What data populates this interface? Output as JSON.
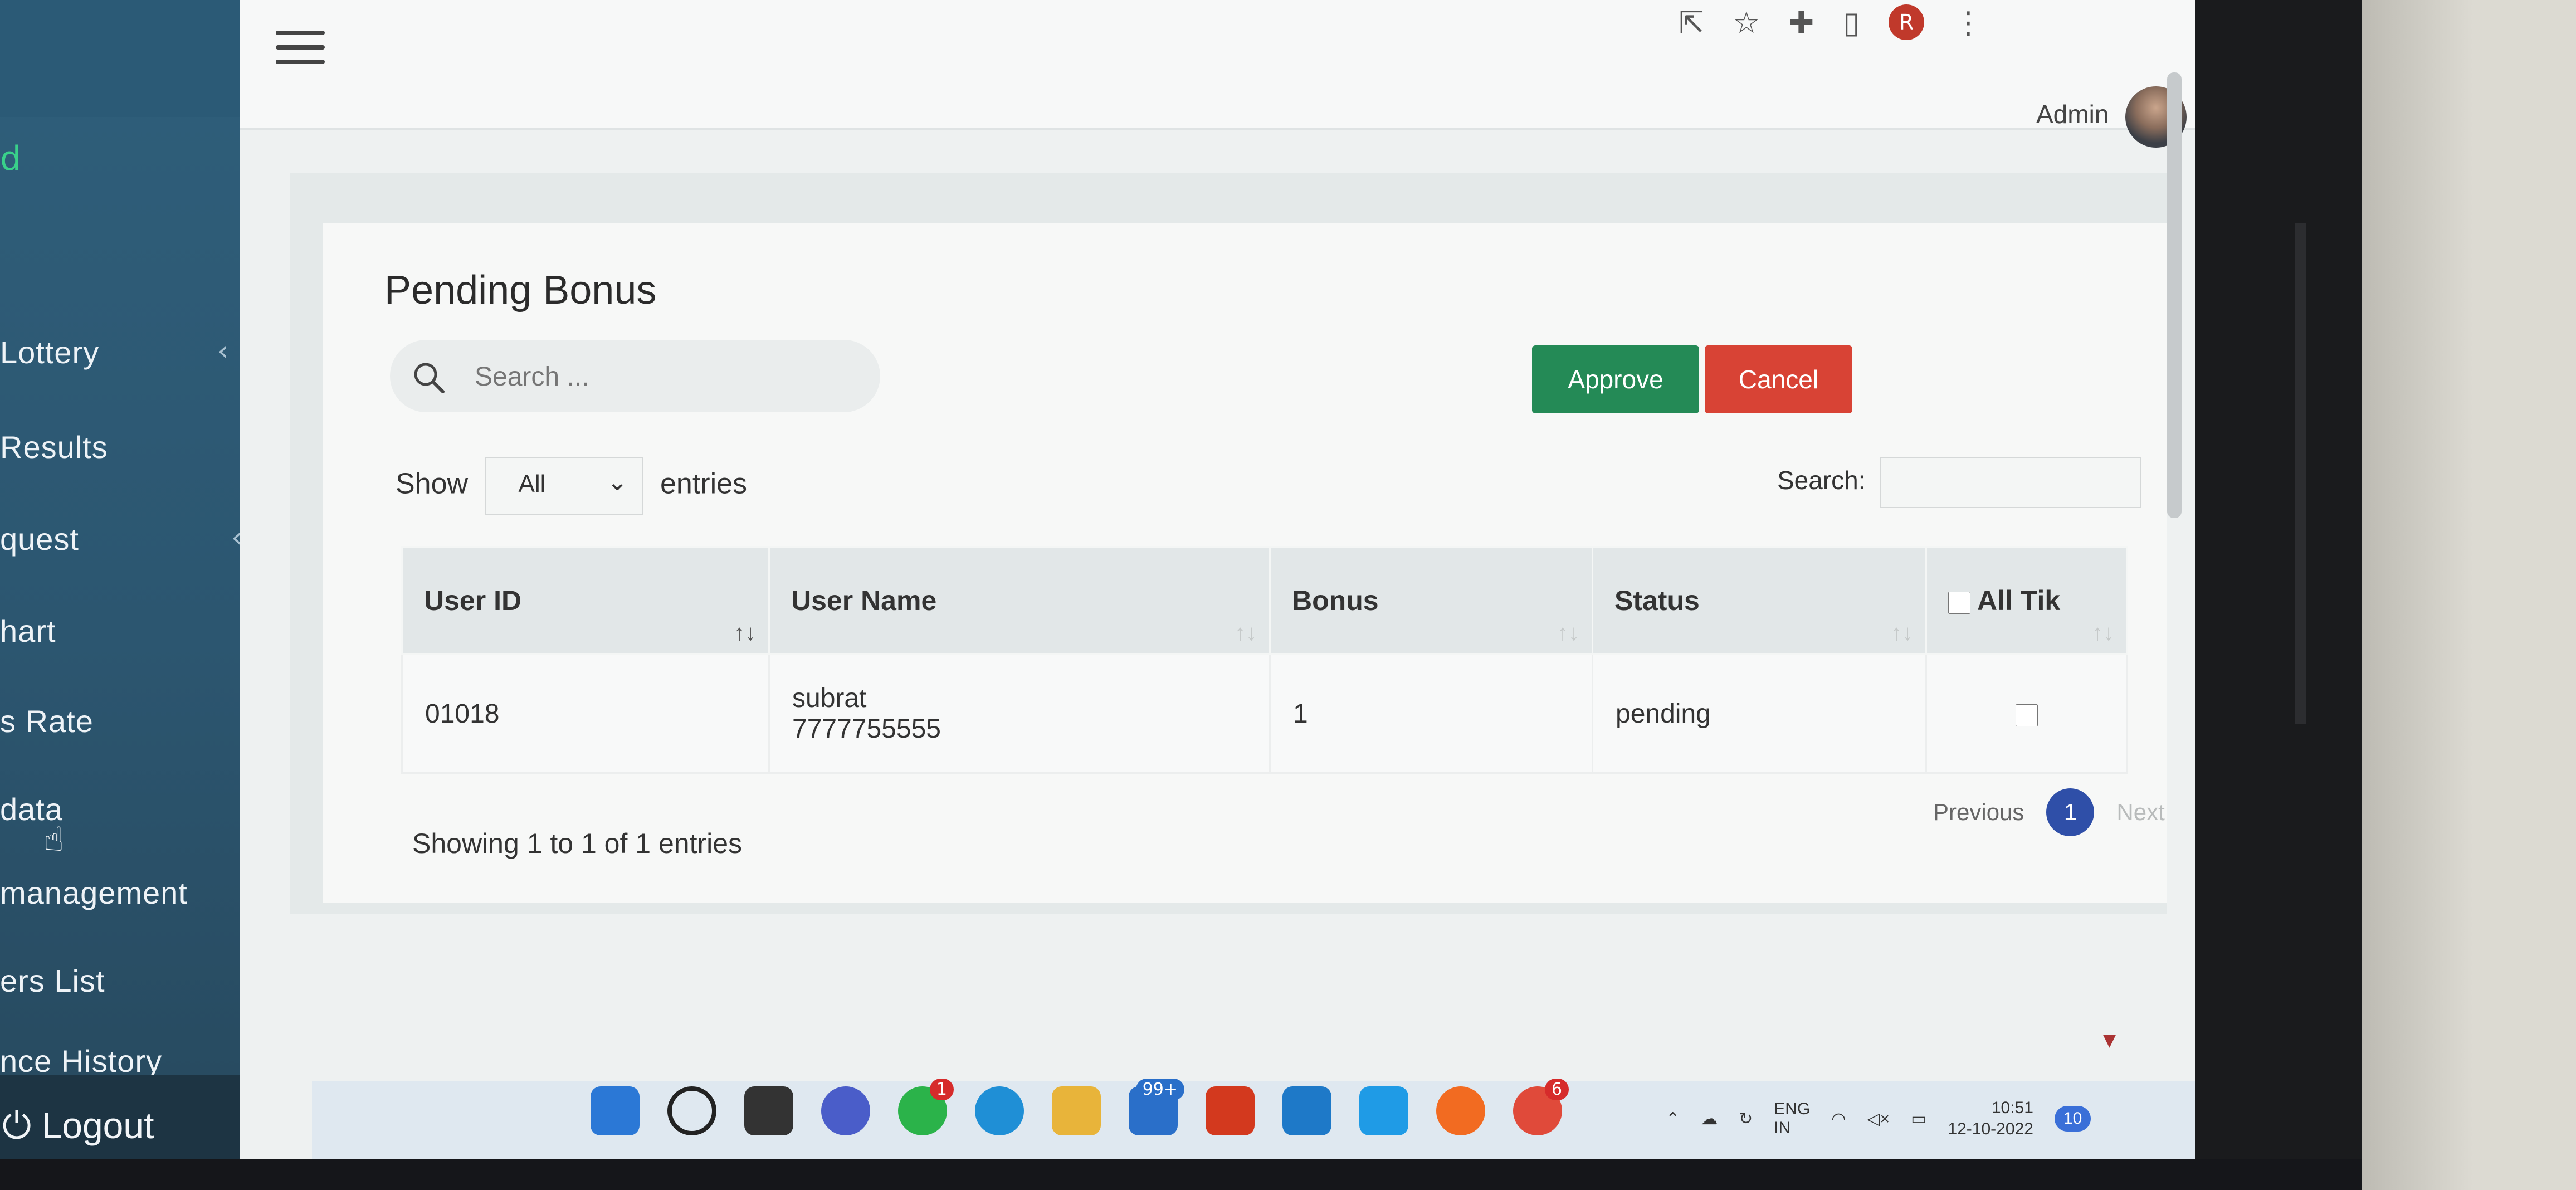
{
  "sidebar": {
    "items": [
      {
        "label": "Lottery",
        "has_submenu": true
      },
      {
        "label": "Results",
        "has_submenu": false
      },
      {
        "label": "quest",
        "has_submenu": true
      },
      {
        "label": "hart",
        "has_submenu": false
      },
      {
        "label": "s Rate",
        "has_submenu": false
      },
      {
        "label": "data",
        "has_submenu": false
      },
      {
        "label": "management",
        "has_submenu": true
      },
      {
        "label": "ers List",
        "has_submenu": false
      },
      {
        "label": "nce History",
        "has_submenu": false
      }
    ],
    "logout_label": "Logout",
    "submenu_icon": "chevron-left-icon",
    "logout_icon": "power-icon"
  },
  "browser": {
    "icons": [
      "share-icon",
      "star-icon",
      "extensions-icon",
      "sidebar-icon",
      "profile-icon",
      "more-icon"
    ],
    "profile_initial": "R"
  },
  "header": {
    "menu_icon": "hamburger-icon",
    "user_label": "Admin"
  },
  "page": {
    "title": "Pending Bonus",
    "search_placeholder": "Search ...",
    "approve_label": "Approve",
    "cancel_label": "Cancel",
    "show_label": "Show",
    "entries_label": "entries",
    "entries_value": "All",
    "table_search_label": "Search:"
  },
  "table": {
    "columns": [
      "User ID",
      "User Name",
      "Bonus",
      "Status",
      "All Tik"
    ],
    "rows": [
      {
        "user_id": "01018",
        "user_name": "subrat",
        "phone": "7777755555",
        "bonus": "1",
        "status": "pending",
        "checked": false
      }
    ],
    "info": "Showing 1 to 1 of 1 entries",
    "pagination": {
      "previous": "Previous",
      "current_page": "1",
      "next": "Next"
    }
  },
  "taskbar": {
    "icons": [
      "windows-icon",
      "search-icon",
      "taskview-icon",
      "chat-icon",
      "whatsapp-icon",
      "edge-icon",
      "folder-icon",
      "mail-icon",
      "office-icon",
      "vscode-icon",
      "skype-icon",
      "firefox-icon",
      "chrome-icon"
    ],
    "whatsapp_badge": "1",
    "mail_badge": "99+",
    "chrome_badge": "6",
    "language": "ENG",
    "region": "IN",
    "time": "10:51",
    "date": "12-10-2022",
    "notification_count": "10"
  },
  "colors": {
    "sidebar_bg": "#2c5670",
    "approve_bg": "#248a56",
    "cancel_bg": "#d84335",
    "page_active": "#2f4fa8"
  }
}
